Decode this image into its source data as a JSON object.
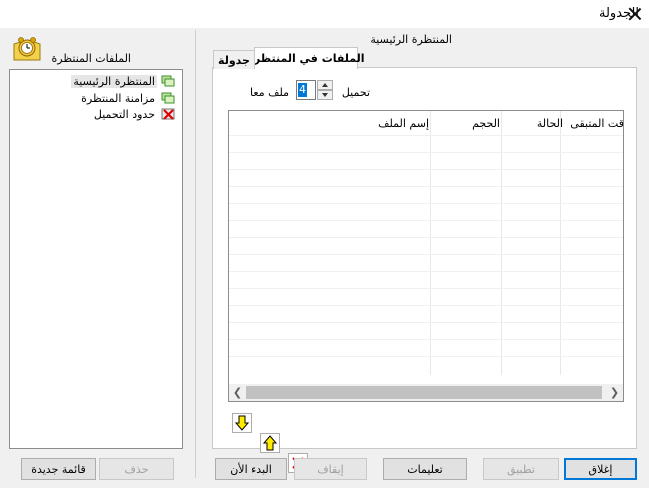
{
  "window": {
    "title": "الجدولة"
  },
  "sidebar": {
    "title": "الملفات المنتظرة",
    "items": [
      {
        "label": "المنتظرة الرئيسية",
        "icon": "queue-icon",
        "selected": true
      },
      {
        "label": "مزامنة المنتظرة",
        "icon": "queue-icon",
        "selected": false
      },
      {
        "label": "حدود التحميل",
        "icon": "limit-icon",
        "selected": false
      }
    ],
    "new_list_label": "قائمة جديدة",
    "delete_label": "حذف"
  },
  "panel": {
    "title": "المنتظرة الرئيسية",
    "tabs": [
      {
        "label": "الملفات في المنتظرة",
        "active": true
      },
      {
        "label": "جدولة",
        "active": false
      }
    ],
    "download_label": "تحميل",
    "concurrent_value": "4",
    "files_at_once_label": "ملف معا",
    "columns": [
      {
        "label": "قت المتبقى"
      },
      {
        "label": "الحالة"
      },
      {
        "label": "الحجم"
      },
      {
        "label": "إسم الملف"
      }
    ]
  },
  "footer": {
    "start_now": "البدء الأن",
    "stop": "إيقاف",
    "help": "تعليمات",
    "apply": "تطبيق",
    "close": "إغلاق"
  },
  "colors": {
    "accent": "#0078d7",
    "move_arrow": "#ffeb00",
    "delete_x": "#e00000"
  }
}
